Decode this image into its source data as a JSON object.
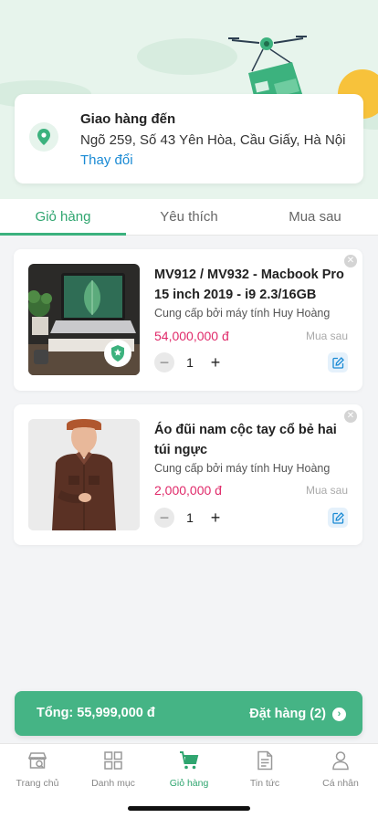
{
  "delivery": {
    "title": "Giao hàng đến",
    "address": "Ngõ 259, Số 43 Yên Hòa, Cầu Giấy, Hà Nội",
    "change_label": "Thay đổi"
  },
  "tabs": [
    {
      "label": "Giỏ hàng",
      "active": true
    },
    {
      "label": "Yêu thích",
      "active": false
    },
    {
      "label": "Mua sau",
      "active": false
    }
  ],
  "cart_items": [
    {
      "name": "MV912 / MV932 - Macbook Pro 15 inch 2019 - i9 2.3/16GB",
      "seller": "Cung cấp bởi máy tính Huy Hoàng",
      "price": "54,000,000 đ",
      "save_later": "Mua sau",
      "quantity": "1"
    },
    {
      "name": "Áo đũi nam cộc tay cổ bẻ hai túi ngực",
      "seller": "Cung cấp bởi máy tính Huy Hoàng",
      "price": "2,000,000 đ",
      "save_later": "Mua sau",
      "quantity": "1"
    }
  ],
  "summary": {
    "total": "Tổng: 55,999,000 đ",
    "checkout": "Đặt hàng (2)"
  },
  "bottom_nav": [
    {
      "label": "Trang chủ",
      "icon": "store-icon",
      "active": false
    },
    {
      "label": "Danh mục",
      "icon": "grid-icon",
      "active": false
    },
    {
      "label": "Giỏ hàng",
      "icon": "cart-icon",
      "active": true
    },
    {
      "label": "Tin tức",
      "icon": "news-icon",
      "active": false
    },
    {
      "label": "Cá nhân",
      "icon": "person-icon",
      "active": false
    }
  ],
  "colors": {
    "primary": "#45b485",
    "price": "#e02a6a",
    "link": "#1a8ad4"
  }
}
